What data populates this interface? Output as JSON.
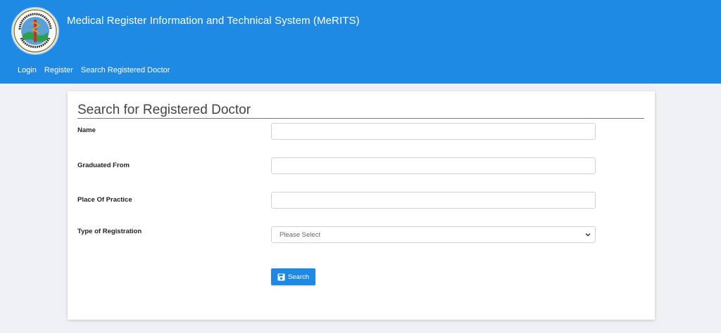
{
  "header": {
    "logo_icon": "medical-council-logo",
    "title": "Medical Register Information and Technical System (MeRITS)",
    "background": "#1f8ae4"
  },
  "nav": {
    "items": [
      "Login",
      "Register",
      "Search Registered Doctor"
    ]
  },
  "form": {
    "title": "Search for Registered Doctor",
    "fields": [
      {
        "label": "Name",
        "value": "",
        "placeholder": ""
      },
      {
        "label": "Graduated From",
        "value": "",
        "placeholder": ""
      },
      {
        "label": "Place Of Practice",
        "value": "",
        "placeholder": ""
      },
      {
        "label": "Type of Registration",
        "selected": "Please Select"
      }
    ],
    "search_button": {
      "label": "Search",
      "icon": "floppy-disk-icon",
      "color": "#1e88e5"
    }
  }
}
